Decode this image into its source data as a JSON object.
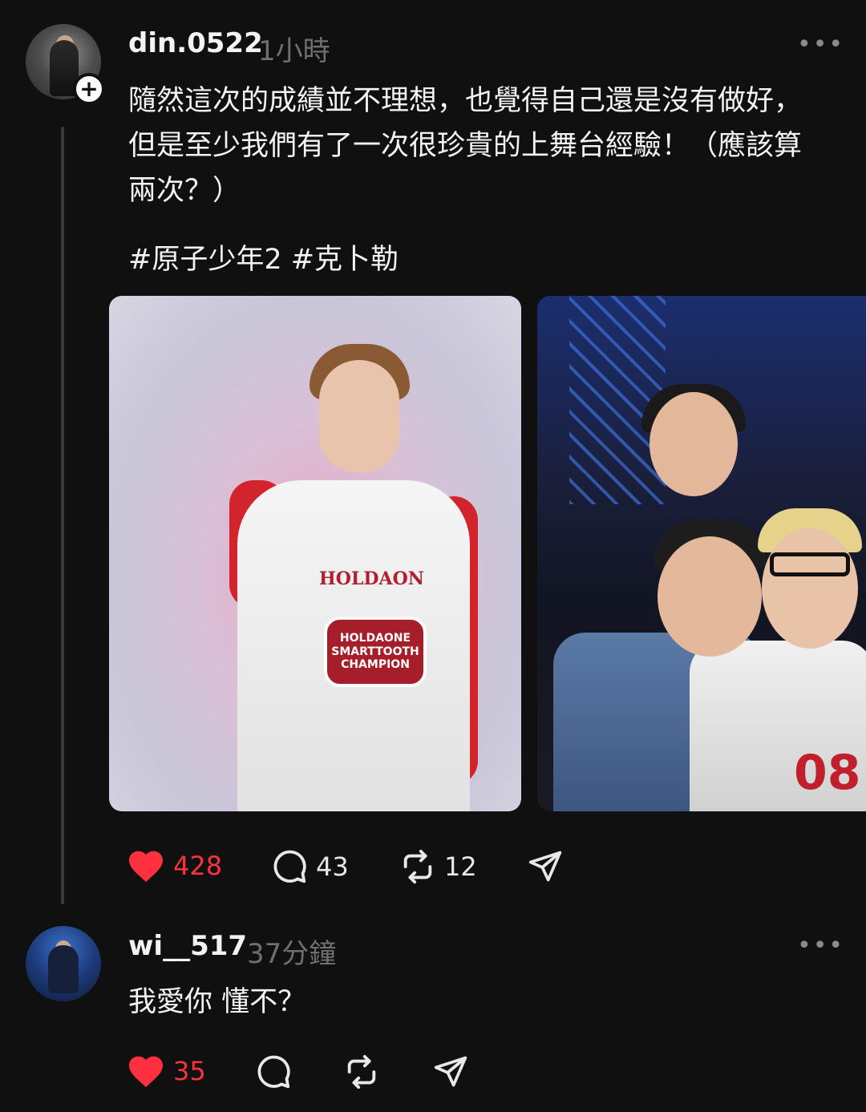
{
  "post": {
    "username": "din.0522",
    "time": "1小時",
    "more": "•••",
    "text": "隨然這次的成績並不理想，也覺得自己還是沒有做好，\n但是至少我們有了一次很珍貴的上舞台經驗！（應該算\n兩次？）",
    "hashtags": "#原子少年2 #克卜勒",
    "image1_text": {
      "jersey": "HOLDAON",
      "badge": "HOLDAONE\nSMARTTOOTH\nCHAMPION"
    },
    "image2_text": {
      "number": "08"
    },
    "actions": {
      "likes": "428",
      "comments": "43",
      "reposts": "12"
    }
  },
  "reply": {
    "username": "wi__517",
    "time": "37分鐘",
    "more": "•••",
    "text": "我愛你 懂不？",
    "actions": {
      "likes": "35"
    }
  },
  "colors": {
    "background": "#101010",
    "like": "#ff3040",
    "muted": "#6f6f6f",
    "text": "#f3f3f3"
  },
  "icons": [
    "heart-icon",
    "comment-icon",
    "repost-icon",
    "share-icon",
    "more-icon",
    "plus-icon"
  ]
}
